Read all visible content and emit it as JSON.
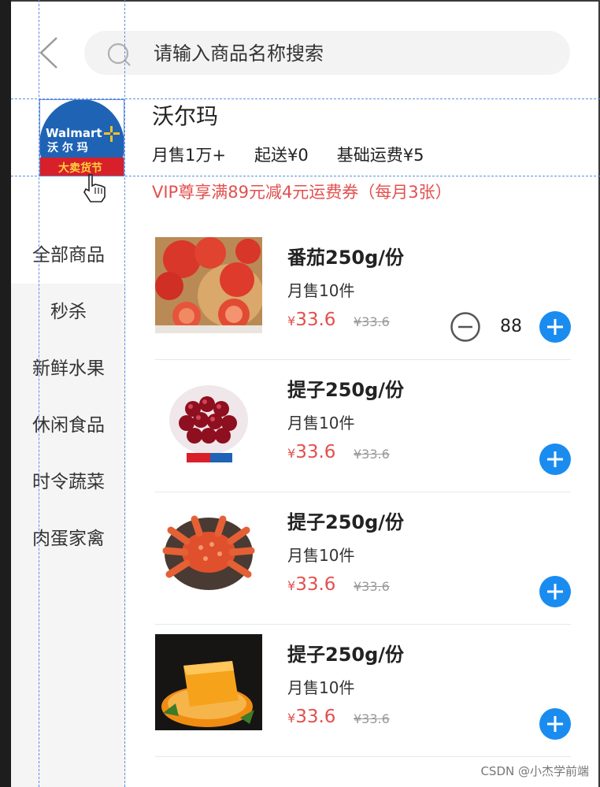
{
  "search": {
    "placeholder": "请输入商品名称搜索"
  },
  "shop": {
    "name": "沃尔玛",
    "monthly_sales": "月售1万+",
    "min_order": "起送¥0",
    "delivery_fee": "基础运费¥5",
    "vip_promo": "VIP尊享满89元减4元运费券（每月3张）",
    "logo": {
      "brand_text": "Walmart",
      "cn_text": "沃 尔 玛",
      "banner_text": "大卖货节"
    }
  },
  "categories": [
    "全部商品",
    "秒杀",
    "新鲜水果",
    "休闲食品",
    "时令蔬菜",
    "肉蛋家禽"
  ],
  "products": [
    {
      "name": "番茄250g/份",
      "sales": "月售10件",
      "currency": "¥",
      "price": "33.6",
      "original_price": "¥33.6",
      "quantity": "88",
      "image": "tomato"
    },
    {
      "name": "提子250g/份",
      "sales": "月售10件",
      "currency": "¥",
      "price": "33.6",
      "original_price": "¥33.6",
      "image": "cherries"
    },
    {
      "name": "提子250g/份",
      "sales": "月售10件",
      "currency": "¥",
      "price": "33.6",
      "original_price": "¥33.6",
      "image": "crab"
    },
    {
      "name": "提子250g/份",
      "sales": "月售10件",
      "currency": "¥",
      "price": "33.6",
      "original_price": "¥33.6",
      "image": "orange-jelly"
    }
  ],
  "watermark": "CSDN @小杰学前端",
  "colors": {
    "accent": "#1a8cf0",
    "price": "#e2504e",
    "brand": "#1f63b5"
  }
}
